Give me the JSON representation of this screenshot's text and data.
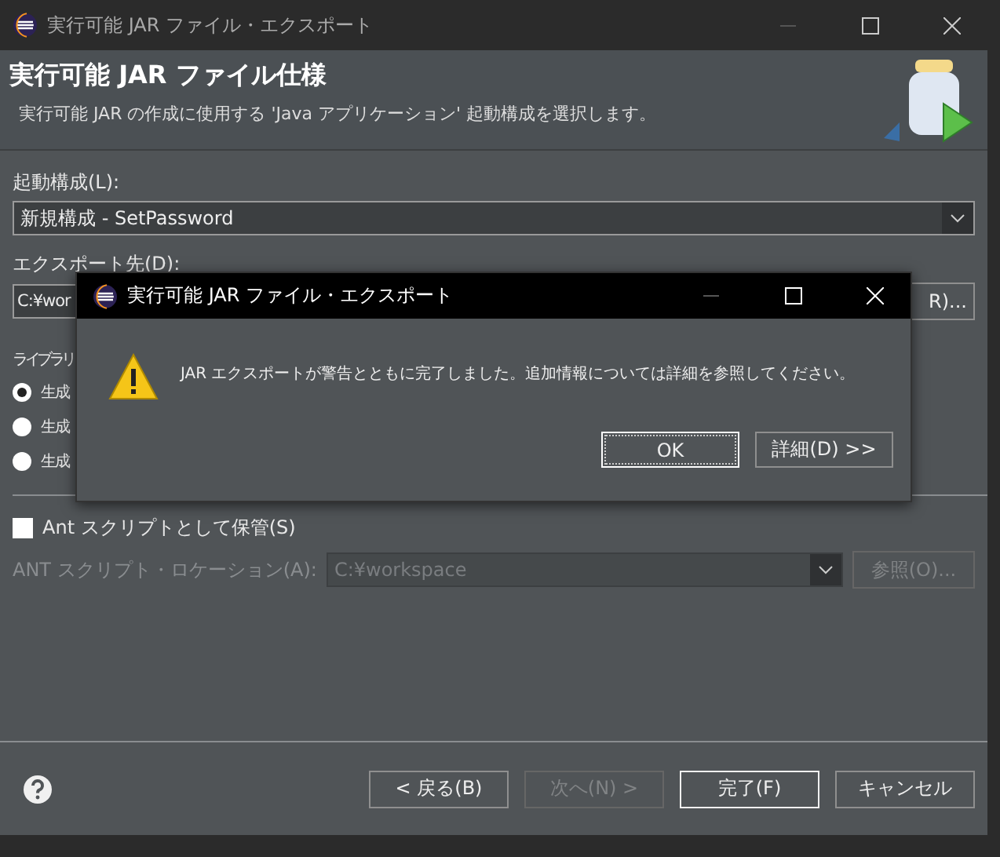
{
  "window": {
    "title": "実行可能 JAR ファイル・エクスポート"
  },
  "header": {
    "title": "実行可能 JAR ファイル仕様",
    "description": "実行可能 JAR の作成に使用する 'Java アプリケーション' 起動構成を選択します。"
  },
  "launch": {
    "label": "起動構成(L):",
    "value": "新規構成 - SetPassword"
  },
  "export": {
    "label": "エクスポート先(D):",
    "value": "C:¥wor",
    "browse": "R)..."
  },
  "library": {
    "label": "ライブラリ",
    "options": [
      {
        "label": "生成",
        "selected": true
      },
      {
        "label": "生成",
        "selected": false
      },
      {
        "label": "生成",
        "selected": false
      }
    ]
  },
  "ant": {
    "checkbox": {
      "label": "Ant スクリプトとして保管(S)",
      "checked": false
    },
    "location_label": "ANT スクリプト・ロケーション(A):",
    "location_value": "C:¥workspace",
    "browse": "参照(O)...",
    "disabled": true
  },
  "buttons": [
    {
      "label": "< 戻る(B)",
      "disabled": false,
      "default": false
    },
    {
      "label": "次へ(N) >",
      "disabled": true,
      "default": false
    },
    {
      "label": "完了(F)",
      "disabled": false,
      "default": true
    },
    {
      "label": "キャンセル",
      "disabled": false,
      "default": false
    }
  ],
  "dialog": {
    "title": "実行可能 JAR ファイル・エクスポート",
    "message": "JAR エクスポートが警告とともに完了しました。追加情報については詳細を参照してください。",
    "buttons": [
      {
        "label": "OK",
        "focused": true
      },
      {
        "label": "詳細(D) >>",
        "focused": false
      }
    ]
  }
}
